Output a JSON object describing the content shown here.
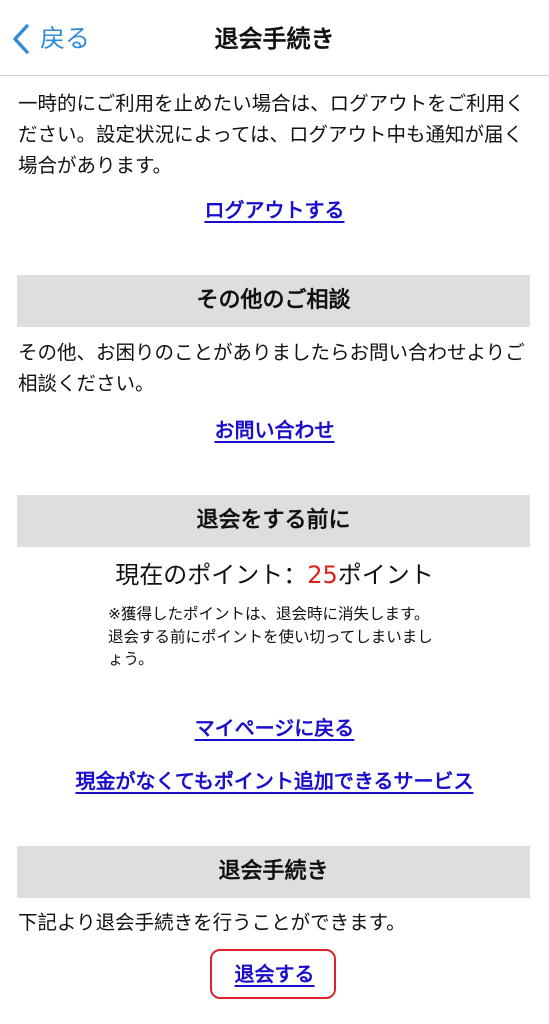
{
  "nav": {
    "back_label": "戻る",
    "title": "退会手続き"
  },
  "logout": {
    "text": "一時的にご利用を止めたい場合は、ログアウトをご利用ください。設定状況によっては、ログアウト中も通知が届く場合があります。",
    "link": "ログアウトする"
  },
  "consult": {
    "header": "その他のご相談",
    "text": "その他、お困りのことがありましたらお問い合わせよりご相談ください。",
    "link": "お問い合わせ"
  },
  "before": {
    "header": "退会をする前に",
    "points_label": "現在のポイント：",
    "points_value": "25",
    "points_unit": "ポイント",
    "note_1": "※獲得したポイントは、退会時に消失します。",
    "note_2": "退会する前にポイントを使い切ってしまいましょう。",
    "mypage_link": "マイページに戻る",
    "service_link": "現金がなくてもポイント追加できるサービス"
  },
  "withdraw": {
    "header": "退会手続き",
    "text": "下記より退会手続きを行うことができます。",
    "link": "退会する"
  },
  "colors": {
    "accent_blue": "#2f8bd8",
    "link": "#1a0dcc",
    "points_red": "#e0201b",
    "highlight_border": "#d9262a",
    "section_bg": "#dedede"
  }
}
